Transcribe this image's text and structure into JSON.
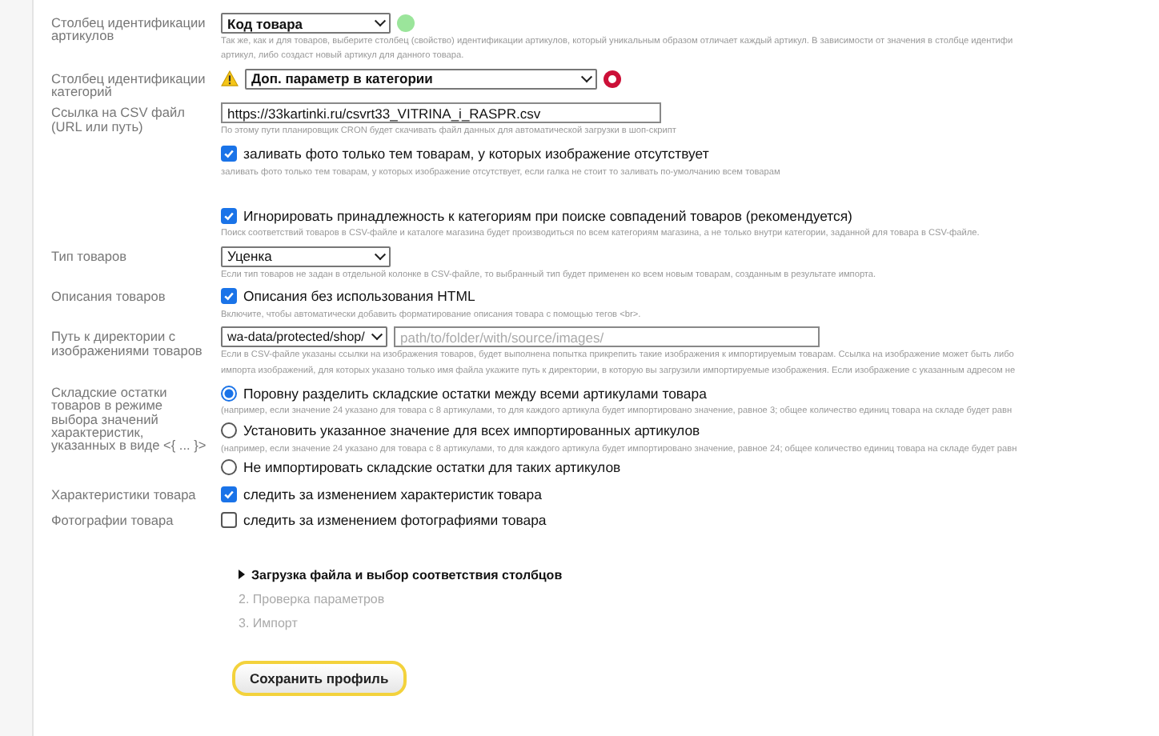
{
  "rows": [
    {
      "kind": "select",
      "label": "Столбец идентификации артикулов",
      "value": "Код товара",
      "wide": false,
      "bold": true,
      "warning": false,
      "color": "#9be59b",
      "hint_lines": [
        "Так же, как и для товаров, выберите столбец (свойство) идентификации артикулов, который уникальным образом отличает каждый артикул. В зависимости от значения в столбце идентифи",
        "артикул, либо создаст новый артикул для данного товара."
      ]
    },
    {
      "kind": "select",
      "label": "Столбец идентификации категорий",
      "value": "Доп. параметр в категории",
      "wide": true,
      "bold": true,
      "warning": true,
      "color": "#cc1038",
      "hint_lines": []
    },
    {
      "kind": "input",
      "label": "Ссылка на CSV файл (URL или путь)",
      "value": "https://33kartinki.ru/csvrt33_VITRINA_i_RASPR.csv",
      "hint_lines": [
        "По этому пути планировщик CRON будет скачивать файл данных для автоматической загрузки в шоп-скрипт"
      ]
    },
    {
      "kind": "checkbox",
      "label": "",
      "text": "заливать фото только тем товарам, у которых изображение отсутствует",
      "checked": true,
      "hint_lines": [
        "заливать фото только тем товарам, у которых изображение отсутствует, если галка не стоит то заливать по-умолчанию всем товарам"
      ]
    },
    {
      "kind": "spacer"
    },
    {
      "kind": "checkbox",
      "label": "",
      "text": "Игнорировать принадлежность к категориям при поиске совпадений товаров (рекомендуется)",
      "checked": true,
      "hint_lines": [
        "Поиск соответствий товаров в CSV-файле и каталоге магазина будет производиться по всем категориям магазина, а не только внутри категории, заданной для товара в CSV-файле."
      ]
    },
    {
      "kind": "select",
      "label": "Тип товаров",
      "value": "Уценка",
      "wide": false,
      "bold": false,
      "warning": false,
      "hint_lines": [
        "Если тип товаров не задан в отдельной колонке в CSV-файле, то выбранный тип будет применен ко всем новым товарам, созданным в результате импорта."
      ]
    },
    {
      "kind": "checkbox",
      "label": "Описания товаров",
      "text": "Описания без использования HTML",
      "checked": true,
      "hint_lines": [
        "Включите, чтобы автоматически добавить форматирование описания товара с помощью тегов <br>."
      ]
    },
    {
      "kind": "path",
      "label": "Путь к директории с изображениями товаров",
      "value": "wa-data/protected/shop/",
      "placeholder": "path/to/folder/with/source/images/",
      "hint_lines": [
        "Если в CSV-файле указаны ссылки на изображения товаров, будет выполнена попытка прикрепить такие изображения к импортируемым товарам. Ссылка на изображение может быть либо",
        "импорта изображений, для которых указано только имя файла укажите путь к директории, в которую вы загрузили импортируемые изображения. Если изображение с указанным адресом не"
      ]
    },
    {
      "kind": "radios",
      "label": "Складские остатки товаров в режиме выбора значений характеристик, указанных в виде <{ ... }>",
      "options": [
        {
          "text": "Поровну разделить складские остатки между всеми артикулами товара",
          "selected": true,
          "hint": "(например, если значение 24 указано для товара с 8 артикулами, то для каждого артикула будет импортировано значение, равное 3; общее количество единиц товара на складе будет равн"
        },
        {
          "text": "Установить указанное значение для всех импортированных артикулов",
          "selected": false,
          "hint": "(например, если значение 24 указано для товара с 8 артикулами, то для каждого артикула будет импортировано значение, равное 24; общее количество единиц товара на складе будет равн"
        },
        {
          "text": "Не импортировать складские остатки для таких артикулов",
          "selected": false
        }
      ]
    },
    {
      "kind": "checkbox",
      "label": "Характеристики товара",
      "text": "следить за изменением характеристик товара",
      "checked": true,
      "hint_lines": []
    },
    {
      "kind": "checkbox",
      "label": "Фотографии товара",
      "text": "следить за изменением фотографиями товара",
      "checked": false,
      "hint_lines": []
    }
  ],
  "steps": [
    {
      "text": "Загрузка файла и выбор соответствия столбцов",
      "selected": true
    },
    {
      "text": "2. Проверка параметров",
      "selected": false
    },
    {
      "text": "3. Импорт",
      "selected": false
    }
  ],
  "save_button": "Сохранить профиль"
}
